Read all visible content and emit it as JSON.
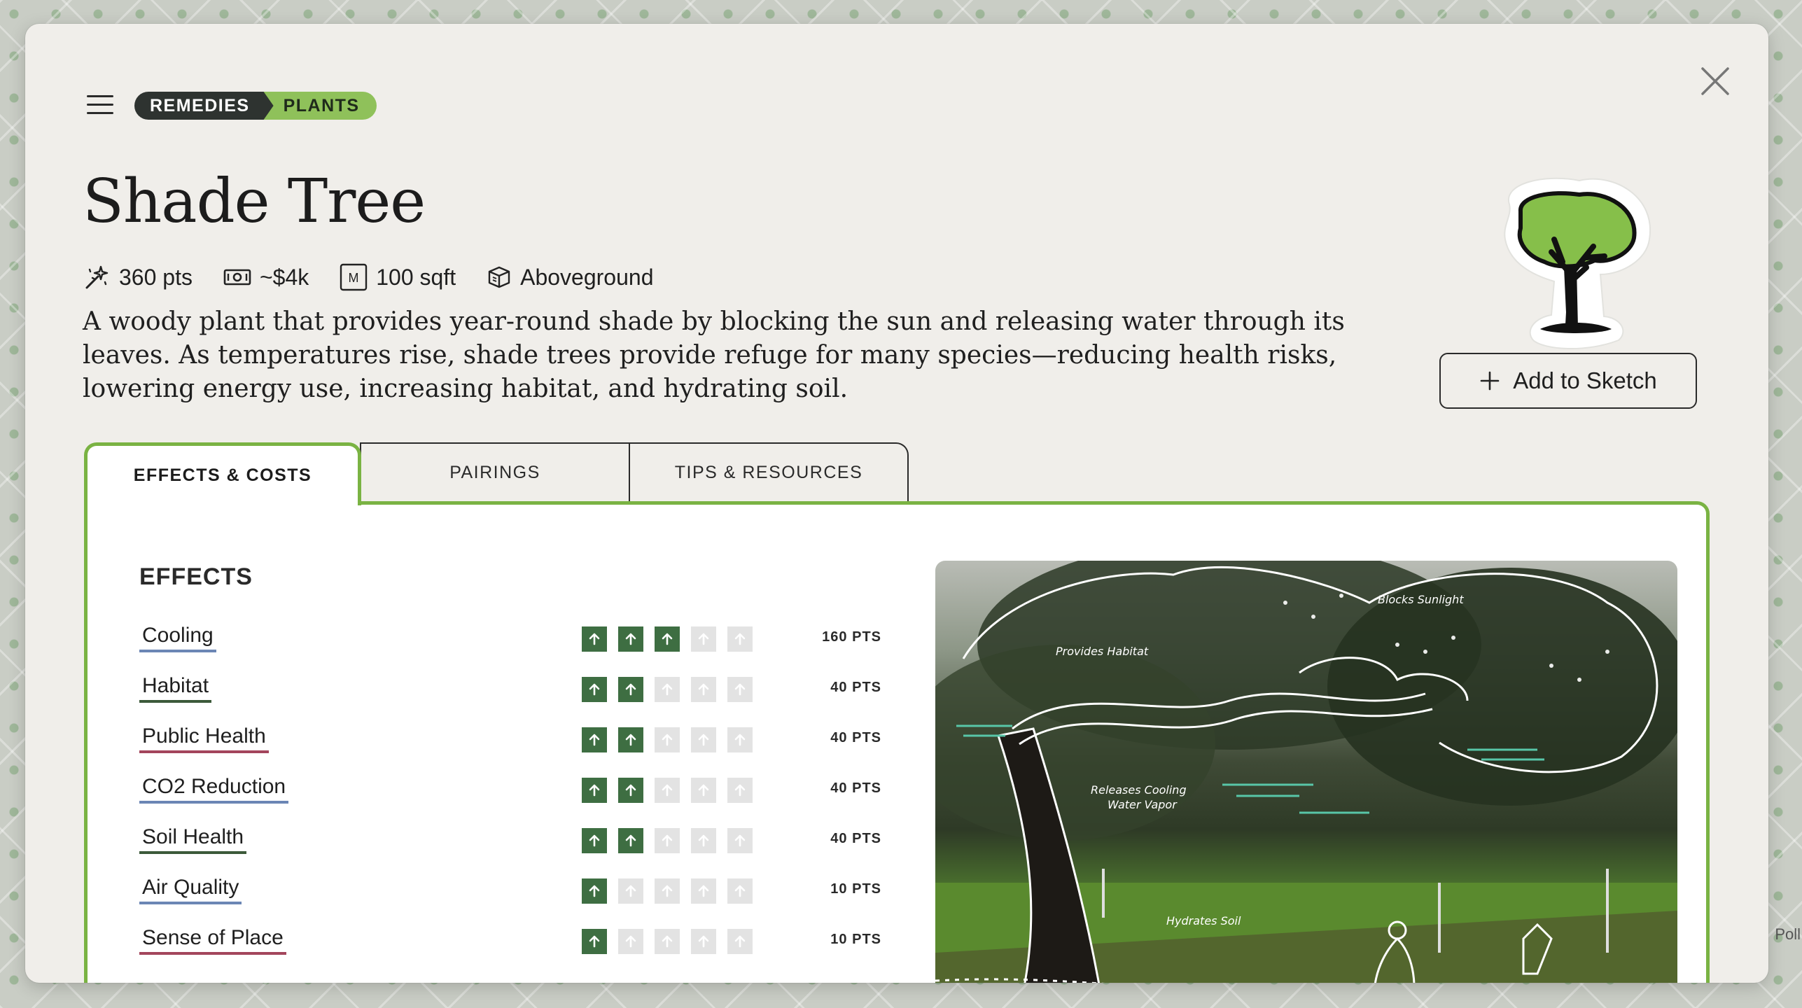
{
  "background": {
    "map_label": "Poll"
  },
  "header": {
    "breadcrumb": [
      "REMEDIES",
      "PLANTS"
    ],
    "title": "Shade Tree"
  },
  "meta": {
    "points": "360 pts",
    "cost": "~$4k",
    "size_badge": "M",
    "area": "100 sqft",
    "placement": "Aboveground"
  },
  "description": "A woody plant that provides year-round shade by blocking the sun and releasing water through its leaves. As temperatures rise, shade trees provide refuge for many species—reducing health risks, lowering energy use, increasing habitat, and hydrating soil.",
  "actions": {
    "add_to_sketch": "Add to Sketch"
  },
  "tabs": [
    {
      "label": "EFFECTS & COSTS",
      "active": true
    },
    {
      "label": "PAIRINGS",
      "active": false
    },
    {
      "label": "TIPS & RESOURCES",
      "active": false
    }
  ],
  "effects": {
    "heading": "EFFECTS",
    "max_level": 5,
    "items": [
      {
        "label": "Cooling",
        "level": 3,
        "points": "160 PTS",
        "underline": "#6b86b5"
      },
      {
        "label": "Habitat",
        "level": 2,
        "points": "40 PTS",
        "underline": "#3c5a3a"
      },
      {
        "label": "Public Health",
        "level": 2,
        "points": "40 PTS",
        "underline": "#a3455c"
      },
      {
        "label": "CO2 Reduction",
        "level": 2,
        "points": "40 PTS",
        "underline": "#6b86b5"
      },
      {
        "label": "Soil Health",
        "level": 2,
        "points": "40 PTS",
        "underline": "#3c5a3a"
      },
      {
        "label": "Air Quality",
        "level": 1,
        "points": "10 PTS",
        "underline": "#6b86b5"
      },
      {
        "label": "Sense of Place",
        "level": 1,
        "points": "10 PTS",
        "underline": "#a3455c"
      }
    ]
  },
  "illustration": {
    "labels": {
      "blocks_sunlight": "Blocks Sunlight",
      "provides_habitat": "Provides Habitat",
      "releases_cooling": "Releases Cooling",
      "water_vapor": "Water Vapor",
      "hydrates_soil": "Hydrates Soil"
    }
  },
  "colors": {
    "accent_green": "#7ab343",
    "arrow_active": "#3e6e42",
    "arrow_inactive": "#e3e3e3",
    "breadcrumb_dark": "#2e3330",
    "breadcrumb_green": "#8fc15a"
  }
}
